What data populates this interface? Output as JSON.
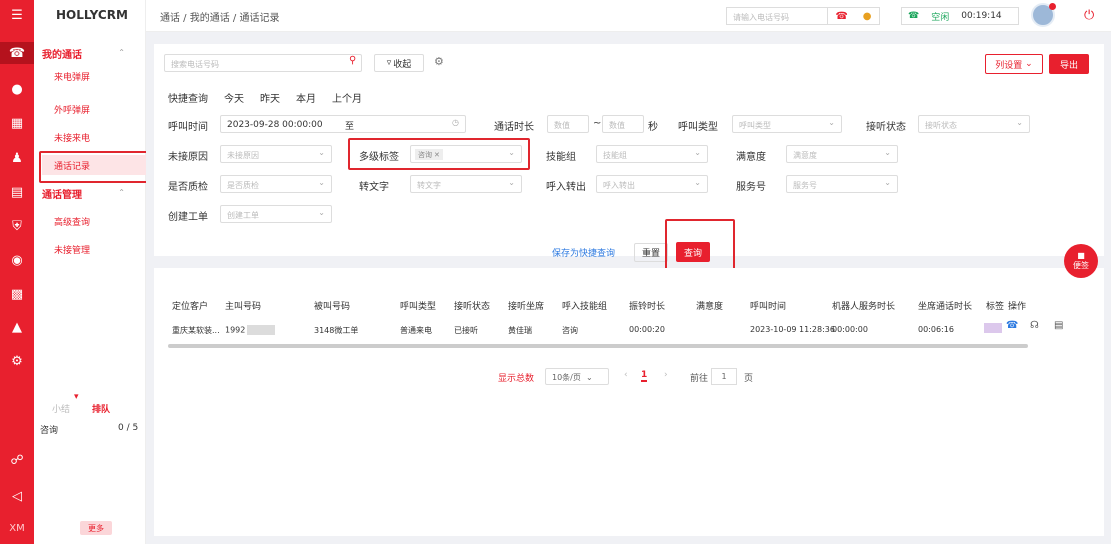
{
  "app": {
    "brand": "HOLLYCRM"
  },
  "rail": {
    "xm_label": "XM"
  },
  "sidebar": {
    "group1": {
      "label": "我的通话"
    },
    "items1": [
      "来电弹屏",
      "外呼弹屏",
      "未接来电",
      "通话记录"
    ],
    "group2": {
      "label": "通话管理"
    },
    "items2": [
      "高级查询",
      "未接管理"
    ],
    "queue": {
      "tab1": "小结",
      "tab2": "排队",
      "row_label": "咨询",
      "row_value": "0 / 5"
    },
    "more_label": "更多"
  },
  "topbar": {
    "breadcrumb": "通话 / 我的通话 / 通话记录",
    "phone_placeholder": "请输入电话号码",
    "status": "空闲",
    "timer": "00:19:14"
  },
  "toolbar": {
    "search_placeholder": "搜索电话号码",
    "collapse_label": "收起",
    "column_settings": "列设置",
    "export": "导出"
  },
  "quick": {
    "label": "快捷查询",
    "options": [
      "今天",
      "昨天",
      "本月",
      "上个月"
    ]
  },
  "filters": {
    "call_time": {
      "label": "呼叫时间",
      "start": "2023-09-28 00:00:00",
      "sep": "至"
    },
    "duration": {
      "label": "通话时长",
      "min_ph": "数值",
      "max_ph": "数值",
      "tilde": "~",
      "unit": "秒"
    },
    "call_type": {
      "label": "呼叫类型",
      "placeholder": "呼叫类型"
    },
    "answer_status": {
      "label": "接听状态",
      "placeholder": "接听状态"
    },
    "missed_reason": {
      "label": "未接原因",
      "placeholder": "未接原因"
    },
    "multi_tag": {
      "label": "多级标签",
      "chip": "咨询"
    },
    "skill_group": {
      "label": "技能组",
      "placeholder": "技能组"
    },
    "satisfaction": {
      "label": "满意度",
      "placeholder": "满意度"
    },
    "qc": {
      "label": "是否质检",
      "placeholder": "是否质检"
    },
    "transcribe": {
      "label": "转文字",
      "placeholder": "转文字"
    },
    "transfer": {
      "label": "呼入转出",
      "placeholder": "呼入转出"
    },
    "service_no": {
      "label": "服务号",
      "placeholder": "服务号"
    },
    "ticket": {
      "label": "创建工单",
      "placeholder": "创建工单"
    }
  },
  "actions": {
    "save_quick": "保存为快捷查询",
    "reset": "重置",
    "query": "查询"
  },
  "table": {
    "headers": [
      "定位客户",
      "主叫号码",
      "被叫号码",
      "呼叫类型",
      "接听状态",
      "接听坐席",
      "呼入技能组",
      "振铃时长",
      "满意度",
      "呼叫时间",
      "机器人服务时长",
      "坐席通话时长",
      "标签",
      "操作"
    ],
    "row": {
      "customer": "重庆某软装...",
      "caller": "1992",
      "callee": "3148微工单",
      "call_type": "普通来电",
      "answer_status": "已接听",
      "agent": "黄佳瑞",
      "skill_group": "咨询",
      "ring": "00:00:20",
      "satisfaction": "",
      "call_time": "2023-10-09 11:28:36",
      "robot": "00:00:00",
      "talk": "00:06:16"
    }
  },
  "pagination": {
    "total_label": "显示总数",
    "page_size": "10条/页",
    "current": "1",
    "goto": "前往",
    "goto_value": "1",
    "page_unit": "页"
  },
  "float": {
    "label": "便签"
  },
  "colors": {
    "brand_red": "#e8202e",
    "link_blue": "#2d7ae0",
    "status_green": "#19a55a"
  }
}
